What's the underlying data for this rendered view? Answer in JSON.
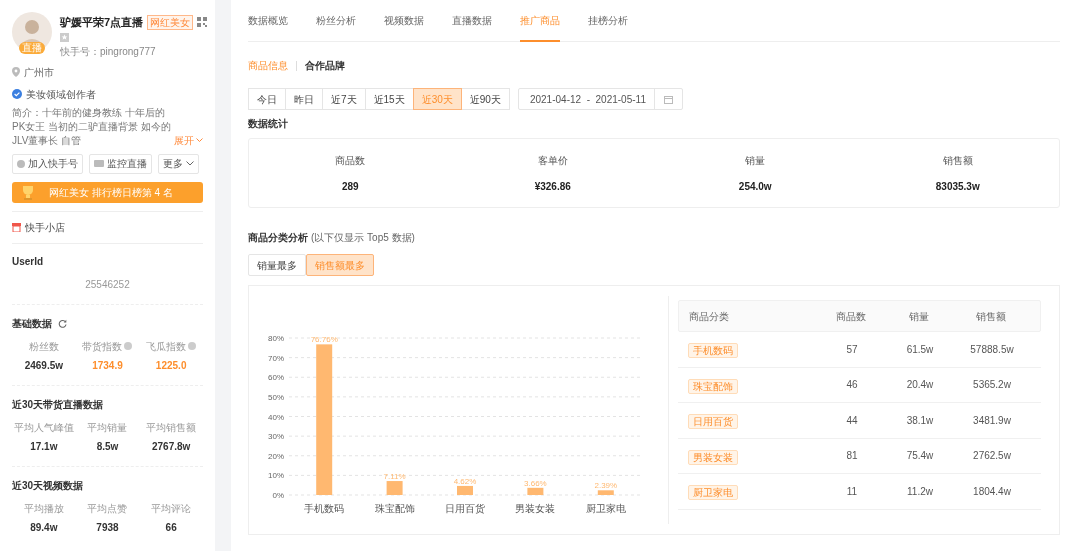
{
  "profile": {
    "avatar_badge": "直播",
    "name": "驴媛平荣7点直播",
    "tag": "网红美女",
    "account": "快手号：pingrong777",
    "city": "广州市",
    "creator": "美妆领域创作者",
    "intro": "简介：十年前的健身教练 十年后的PK女王 当初的二驴直播背景 如今的JLV董事长 自管",
    "expand": "展开"
  },
  "actions": [
    "加入快手号",
    "监控直播",
    "更多"
  ],
  "rank_banner": "网红美女 排行榜日榜第 4 名",
  "shop": "快手小店",
  "userid": {
    "title": "UserId",
    "value": "25546252"
  },
  "sections": [
    {
      "title": "基础数据",
      "refresh": true,
      "stats": [
        {
          "label": "粉丝数",
          "value": "2469.5w",
          "help": false,
          "highlight": false
        },
        {
          "label": "带货指数",
          "value": "1734.9",
          "help": true,
          "highlight": true
        },
        {
          "label": "飞瓜指数",
          "value": "1225.0",
          "help": true,
          "highlight": true
        }
      ]
    },
    {
      "title": "近30天带货直播数据",
      "refresh": false,
      "stats": [
        {
          "label": "平均人气峰值",
          "value": "17.1w",
          "help": false,
          "highlight": false
        },
        {
          "label": "平均销量",
          "value": "8.5w",
          "help": false,
          "highlight": false
        },
        {
          "label": "平均销售额",
          "value": "2767.8w",
          "help": false,
          "highlight": false
        }
      ]
    },
    {
      "title": "近30天视频数据",
      "refresh": false,
      "stats": [
        {
          "label": "平均播放",
          "value": "89.4w",
          "help": false,
          "highlight": false
        },
        {
          "label": "平均点赞",
          "value": "7938",
          "help": false,
          "highlight": false
        },
        {
          "label": "平均评论",
          "value": "66",
          "help": false,
          "highlight": false
        }
      ]
    }
  ],
  "tabs": [
    {
      "label": "数据概览",
      "selected": false
    },
    {
      "label": "粉丝分析",
      "selected": false
    },
    {
      "label": "视频数据",
      "selected": false
    },
    {
      "label": "直播数据",
      "selected": false
    },
    {
      "label": "推广商品",
      "selected": true
    },
    {
      "label": "挂榜分析",
      "selected": false
    }
  ],
  "subtabs": [
    {
      "label": "商品信息",
      "selected": true
    },
    {
      "label": "合作品牌",
      "selected": false
    }
  ],
  "ranges": [
    {
      "label": "今日",
      "selected": false
    },
    {
      "label": "昨日",
      "selected": false
    },
    {
      "label": "近7天",
      "selected": false
    },
    {
      "label": "近15天",
      "selected": false
    },
    {
      "label": "近30天",
      "selected": true
    },
    {
      "label": "近90天",
      "selected": false
    }
  ],
  "date_range": {
    "start": "2021-04-12",
    "separator": "-",
    "end": "2021-05-11"
  },
  "summary": {
    "title": "数据统计",
    "items": [
      {
        "label": "商品数",
        "value": "289"
      },
      {
        "label": "客单价",
        "value": "¥326.86"
      },
      {
        "label": "销量",
        "value": "254.0w"
      },
      {
        "label": "销售额",
        "value": "83035.3w"
      }
    ]
  },
  "category": {
    "title": "商品分类分析",
    "note": "(以下仅显示 Top5 数据)",
    "toggles": [
      {
        "label": "销量最多",
        "selected": false
      },
      {
        "label": "销售额最多",
        "selected": true
      }
    ],
    "chart_data": {
      "type": "bar",
      "categories": [
        "手机数码",
        "珠宝配饰",
        "日用百货",
        "男装女装",
        "厨卫家电"
      ],
      "series": [
        {
          "color": "#ffb870",
          "values": [
            76.76,
            7.11,
            4.62,
            3.66,
            2.39
          ]
        }
      ],
      "grid": true,
      "ylim": [
        0,
        80
      ],
      "yticks": [
        {
          "value": 0,
          "label": "0%"
        },
        {
          "value": 10,
          "label": "10%"
        },
        {
          "value": 20,
          "label": "20%"
        },
        {
          "value": 30,
          "label": "30%"
        },
        {
          "value": 40,
          "label": "40%"
        },
        {
          "value": 50,
          "label": "50%"
        },
        {
          "value": 60,
          "label": "60%"
        },
        {
          "value": 70,
          "label": "70%"
        },
        {
          "value": 80,
          "label": "80%"
        }
      ],
      "value_labels": [
        "76.76%",
        "7.11%",
        "4.62%",
        "3.66%",
        "2.39%"
      ]
    },
    "table": {
      "columns": [
        "商品分类",
        "商品数",
        "销量",
        "销售额"
      ],
      "rows": [
        [
          "手机数码",
          "57",
          "61.5w",
          "57888.5w"
        ],
        [
          "珠宝配饰",
          "46",
          "20.4w",
          "5365.2w"
        ],
        [
          "日用百货",
          "44",
          "38.1w",
          "3481.9w"
        ],
        [
          "男装女装",
          "81",
          "75.4w",
          "2762.5w"
        ],
        [
          "厨卫家电",
          "11",
          "11.2w",
          "1804.4w"
        ]
      ]
    }
  }
}
